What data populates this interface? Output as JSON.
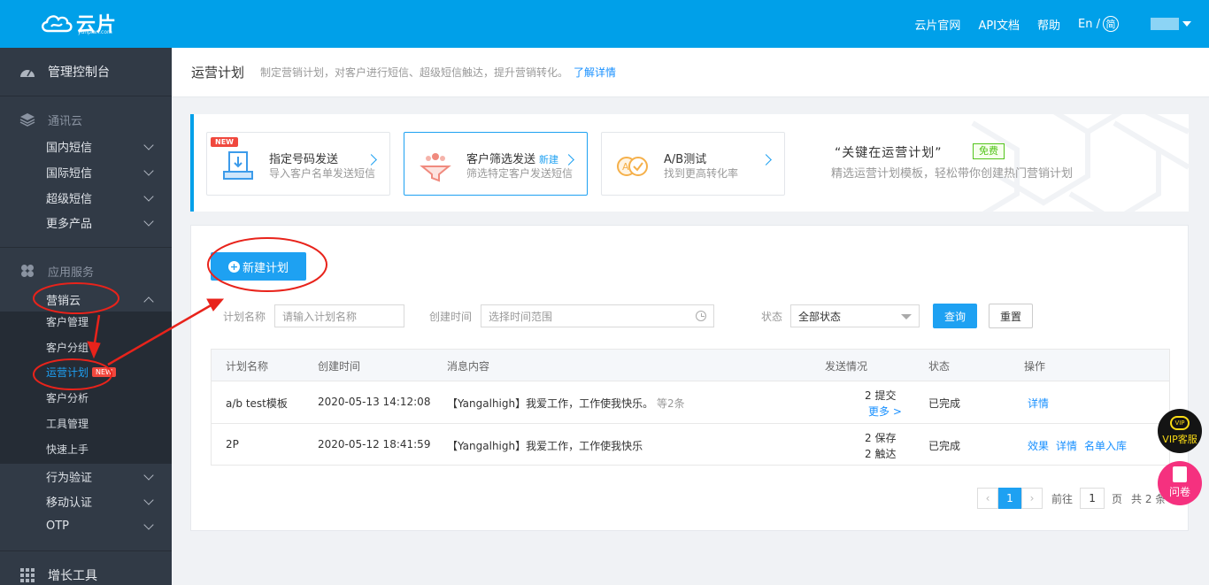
{
  "brand": {
    "name": "云片",
    "sub": "yunpian.com"
  },
  "topnav": {
    "site": "云片官网",
    "api": "API文档",
    "help": "帮助",
    "lang_en": "En /",
    "lang_cn": "简"
  },
  "sidebar": {
    "dashboard": "管理控制台",
    "comm_cloud": "通讯云",
    "domestic_sms": "国内短信",
    "intl_sms": "国际短信",
    "super_sms": "超级短信",
    "more_products": "更多产品",
    "app_services": "应用服务",
    "marketing_cloud": "营销云",
    "sub": {
      "customer_mgmt": "客户管理",
      "customer_group": "客户分组",
      "campaign_plan": "运营计划",
      "customer_analysis": "客户分析",
      "tool_mgmt": "工具管理",
      "quick_start": "快速上手"
    },
    "new_badge": "NEW",
    "behavior_verify": "行为验证",
    "mobile_auth": "移动认证",
    "otp": "OTP",
    "growth_tools": "增长工具"
  },
  "header": {
    "title": "运营计划",
    "desc": "制定营销计划，对客户进行短信、超级短信触达，提升营销转化。",
    "link": "了解详情"
  },
  "cards": [
    {
      "title": "指定号码发送",
      "desc": "导入客户名单发送短信",
      "tag": "",
      "badge": "NEW"
    },
    {
      "title": "客户筛选发送",
      "desc": "筛选特定客户发送短信",
      "tag": "新建",
      "badge": ""
    },
    {
      "title": "A/B测试",
      "desc": "找到更高转化率",
      "tag": "",
      "badge": ""
    }
  ],
  "promo": {
    "title": "“关键在运营计划”",
    "free": "免费",
    "desc": "精选运营计划模板，轻松带你创建热门营销计划"
  },
  "toolbar": {
    "new_plan": "新建计划"
  },
  "filters": {
    "name_label": "计划名称",
    "name_placeholder": "请输入计划名称",
    "time_label": "创建时间",
    "time_placeholder": "选择时间范围",
    "status_label": "状态",
    "status_value": "全部状态",
    "query": "查询",
    "reset": "重置"
  },
  "table": {
    "headers": [
      "计划名称",
      "创建时间",
      "消息内容",
      "发送情况",
      "状态",
      "操作"
    ],
    "rows": [
      {
        "name": "a/b test模板",
        "created": "2020-05-13 14:12:08",
        "content": "【Yangalhigh】我爱工作，工作使我快乐。",
        "extra": "等2条",
        "send_line1": "2   提交",
        "send_line2": "更多 >",
        "status": "已完成",
        "actions": [
          "详情"
        ]
      },
      {
        "name": "2P",
        "created": "2020-05-12 18:41:59",
        "content": "【Yangalhigh】我爱工作，工作使我快乐",
        "extra": "",
        "send_line1": "2   保存",
        "send_line2": "2   触达",
        "status": "已完成",
        "actions": [
          "效果",
          "详情",
          "名单入库"
        ]
      }
    ]
  },
  "pager": {
    "current": "1",
    "goto": "前往",
    "page_input": "1",
    "page_unit": "页",
    "total": "共 2 条"
  },
  "floats": {
    "vip_badge": "VIP",
    "vip": "VIP客服",
    "survey": "问卷"
  },
  "colors": {
    "primary": "#00a0e9",
    "accent": "#1ea1f2",
    "sidebar": "#313a46",
    "annotation": "#e8231b"
  }
}
